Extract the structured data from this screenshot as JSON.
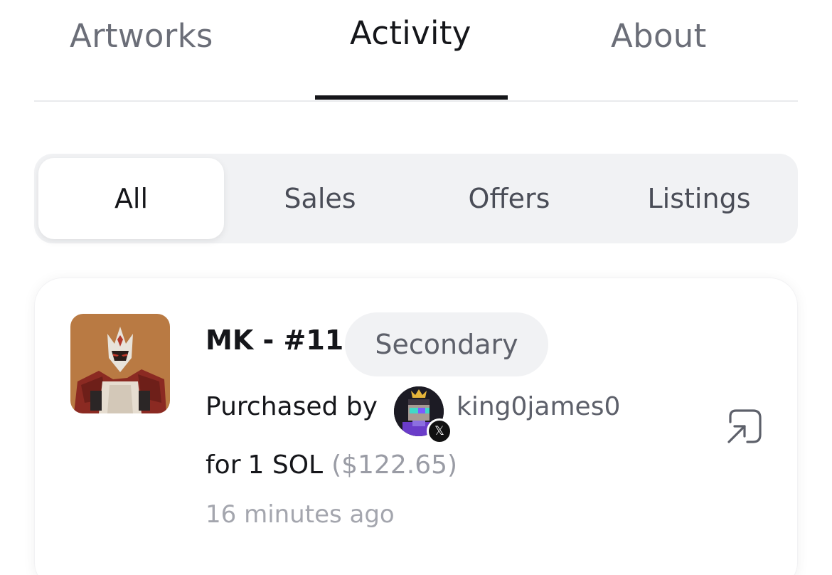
{
  "tabs": {
    "artworks": "Artworks",
    "activity": "Activity",
    "about": "About",
    "active": "activity"
  },
  "filters": {
    "all": "All",
    "sales": "Sales",
    "offers": "Offers",
    "listings": "Listings",
    "selected": "all"
  },
  "activity_items": [
    {
      "title": "MK - #11",
      "badge": "Secondary",
      "purchased_label": "Purchased by",
      "buyer": "king0james0",
      "buyer_social_icon": "x-logo-icon",
      "for_label": "for",
      "amount": "1 SOL",
      "usd": "($122.65)",
      "time": "16 minutes ago",
      "action_icon": "open-external-icon"
    }
  ],
  "colors": {
    "text_primary": "#15161a",
    "text_muted": "#6b6e78",
    "segment_bg": "#f1f2f4",
    "thumb_bg": "#b97a43"
  }
}
